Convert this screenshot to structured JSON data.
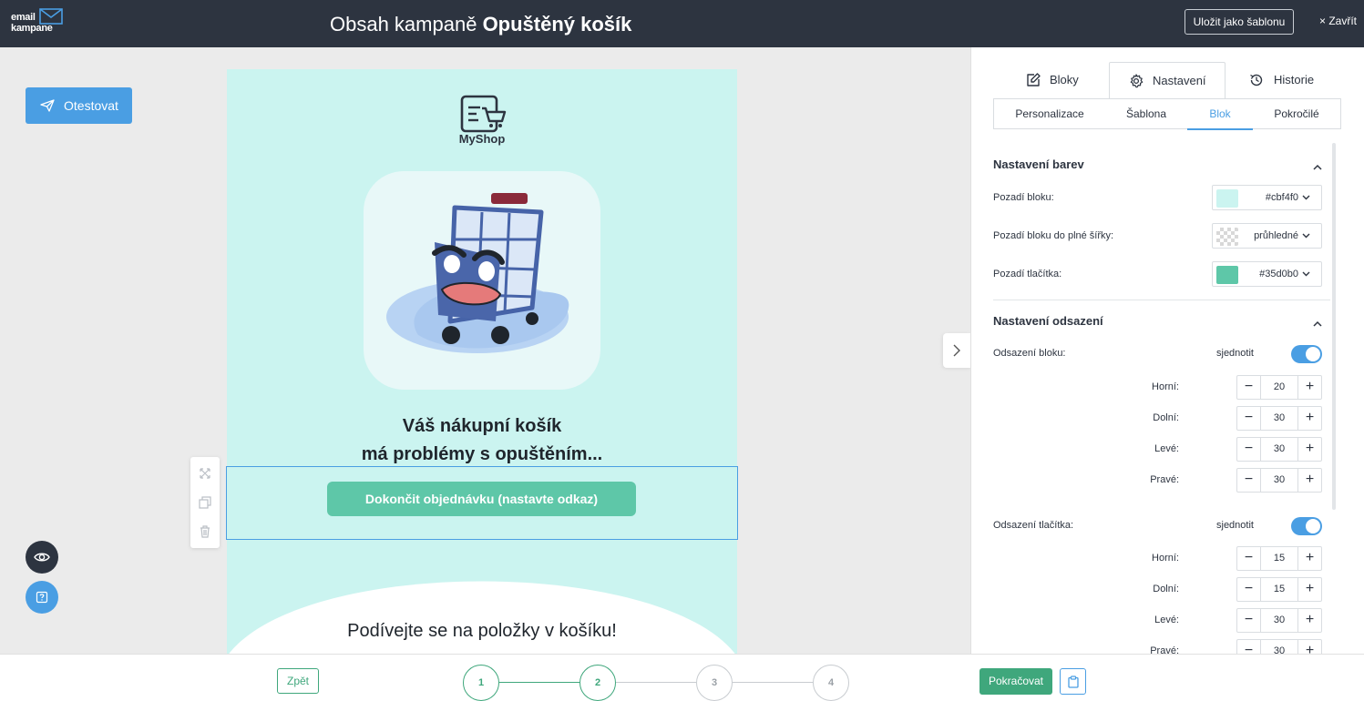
{
  "app": {
    "logo_line1": "email",
    "logo_line2": "kampane",
    "title_prefix": "Obsah kampaně",
    "title_name": "Opuštěný košík",
    "save_template_label": "Uložit jako šablonu",
    "close_label": "× Zavřít"
  },
  "left_tools": {
    "test_label": "Otestovat",
    "preview_icon": "eye-icon",
    "help_icon": "help-icon"
  },
  "email": {
    "shop_name": "MyShop",
    "headline_line1": "Váš nákupní košík",
    "headline_line2": "má problémy s opuštěním...",
    "cta_label": "Dokončit objednávku (nastavte odkaz)",
    "items_heading": "Podívejte se na položky v košíku!",
    "background": "#cbf4f0",
    "button_color": "#5ec7a8"
  },
  "panel": {
    "tabs": [
      {
        "label": "Bloky",
        "icon": "edit-icon"
      },
      {
        "label": "Nastavení",
        "icon": "gear-icon"
      },
      {
        "label": "Historie",
        "icon": "history-icon"
      }
    ],
    "active_tab": "Nastavení",
    "subtabs": [
      "Personalizace",
      "Šablona",
      "Blok",
      "Pokročilé"
    ],
    "active_subtab": "Blok",
    "colors_section": {
      "title": "Nastavení barev",
      "rows": [
        {
          "label": "Pozadí bloku:",
          "value": "#cbf4f0",
          "swatch": "#cbf4f0"
        },
        {
          "label": "Pozadí bloku do plné šířky:",
          "value": "průhledné",
          "swatch": "transparent"
        },
        {
          "label": "Pozadí tlačítka:",
          "value": "#35d0b0",
          "swatch": "#5ec7a8"
        }
      ]
    },
    "padding_section": {
      "title": "Nastavení odsazení",
      "block_padding": {
        "label": "Odsazení bloku:",
        "toggle_label": "sjednotit",
        "toggle_on": true,
        "fields": [
          {
            "label": "Horní:",
            "value": "20"
          },
          {
            "label": "Dolní:",
            "value": "30"
          },
          {
            "label": "Levé:",
            "value": "30"
          },
          {
            "label": "Pravé:",
            "value": "30"
          }
        ]
      },
      "button_padding": {
        "label": "Odsazení tlačítka:",
        "toggle_label": "sjednotit",
        "toggle_on": true,
        "fields": [
          {
            "label": "Horní:",
            "value": "15"
          },
          {
            "label": "Dolní:",
            "value": "15"
          },
          {
            "label": "Levé:",
            "value": "30"
          },
          {
            "label": "Pravé:",
            "value": "30"
          }
        ]
      }
    }
  },
  "bottom": {
    "back_label": "Zpět",
    "steps": [
      "1",
      "2",
      "3",
      "4"
    ],
    "completed_steps": 2,
    "continue_label": "Pokračovat",
    "clipboard_icon": "clipboard-icon"
  },
  "colors": {
    "header": "#2d3440",
    "accent_blue": "#4a9ee3",
    "accent_green": "#3fa77c"
  }
}
